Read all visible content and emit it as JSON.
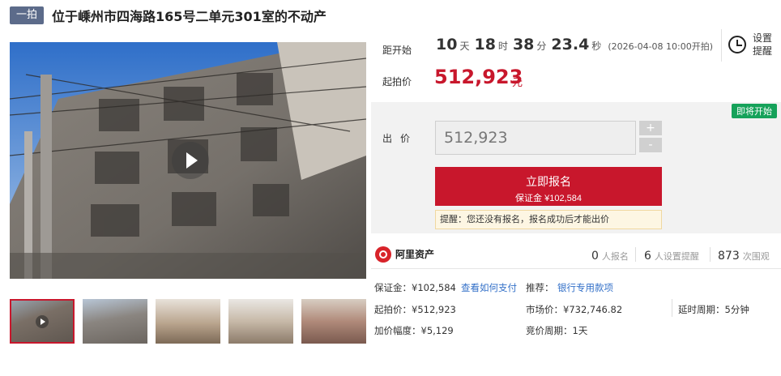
{
  "header": {
    "badge": "一拍",
    "title": "位于嵊州市四海路165号二单元301室的不动产"
  },
  "auction": {
    "countdown_label": "距开始",
    "days": "10",
    "days_unit": "天",
    "hours": "18",
    "hours_unit": "时",
    "minutes": "38",
    "minutes_unit": "分",
    "seconds": "23.4",
    "seconds_unit": "秒",
    "start_time": "(2026-04-08 10:00开拍)",
    "start_price_label": "起拍价",
    "start_price": "512,923",
    "price_unit": "元",
    "remind_line1": "设置",
    "remind_line2": "提醒"
  },
  "bid": {
    "status_tag": "即将开始",
    "label": "出价",
    "value": "512,923",
    "plus": "+",
    "minus": "-",
    "signup_label": "立即报名",
    "deposit_line": "保证金 ¥102,584",
    "warning": "提醒：您还没有报名，报名成功后才能出价"
  },
  "platform": {
    "name": "阿里资产",
    "signups": "0",
    "signups_unit": "人报名",
    "reminders": "6",
    "reminders_unit": "人设置提醒",
    "views": "873",
    "views_unit": "次围观"
  },
  "details": {
    "deposit": "保证金：¥102,584",
    "how_to_pay": "查看如何支付",
    "recommend_label": "推荐：",
    "recommend_link": "银行专用款项",
    "start_price": "起拍价：¥512,923",
    "market_price": "市场价：¥732,746.82",
    "delay_period": "延时周期：5分钟",
    "increment": "加价幅度：¥5,129",
    "bid_period": "竞价周期：1天"
  }
}
